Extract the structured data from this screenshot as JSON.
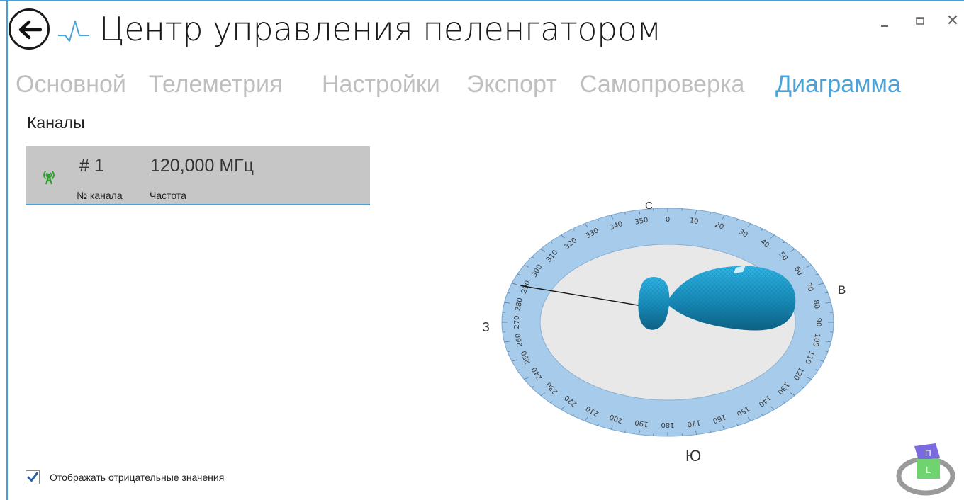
{
  "window": {
    "title": "Центр управления пеленгатором",
    "minimize_glyph": "‒",
    "maximize_glyph": "□",
    "close_glyph": "✕"
  },
  "tabs": [
    {
      "label": "Основной",
      "active": false
    },
    {
      "label": "Телеметрия",
      "active": false
    },
    {
      "label": "Настройки",
      "active": false
    },
    {
      "label": "Экспорт",
      "active": false
    },
    {
      "label": "Самопроверка",
      "active": false
    },
    {
      "label": "Диаграмма",
      "active": true
    }
  ],
  "channels": {
    "heading": "Каналы",
    "items": [
      {
        "number": "# 1",
        "frequency": "120,000 МГц",
        "number_label": "№ канала",
        "frequency_label": "Частота",
        "icon": "antenna-signal-icon",
        "icon_color": "#2e9e2e"
      }
    ]
  },
  "diagram": {
    "cardinals": {
      "north": "С",
      "east": "В",
      "south": "Ю",
      "west": "З"
    },
    "bearing_degrees": 290,
    "ring_color": "#a7cbea",
    "inner_color": "#e8e8e8",
    "lobe_color": "#1a90c0"
  },
  "options": {
    "show_negative_label": "Отображать отрицательные значения",
    "show_negative_checked": true
  },
  "view_cube": {
    "top_face": "П",
    "front_face": "L"
  },
  "colors": {
    "accent": "#4aa3d8",
    "tab_inactive": "#bfbfbf",
    "card_bg": "#c6c6c6"
  }
}
